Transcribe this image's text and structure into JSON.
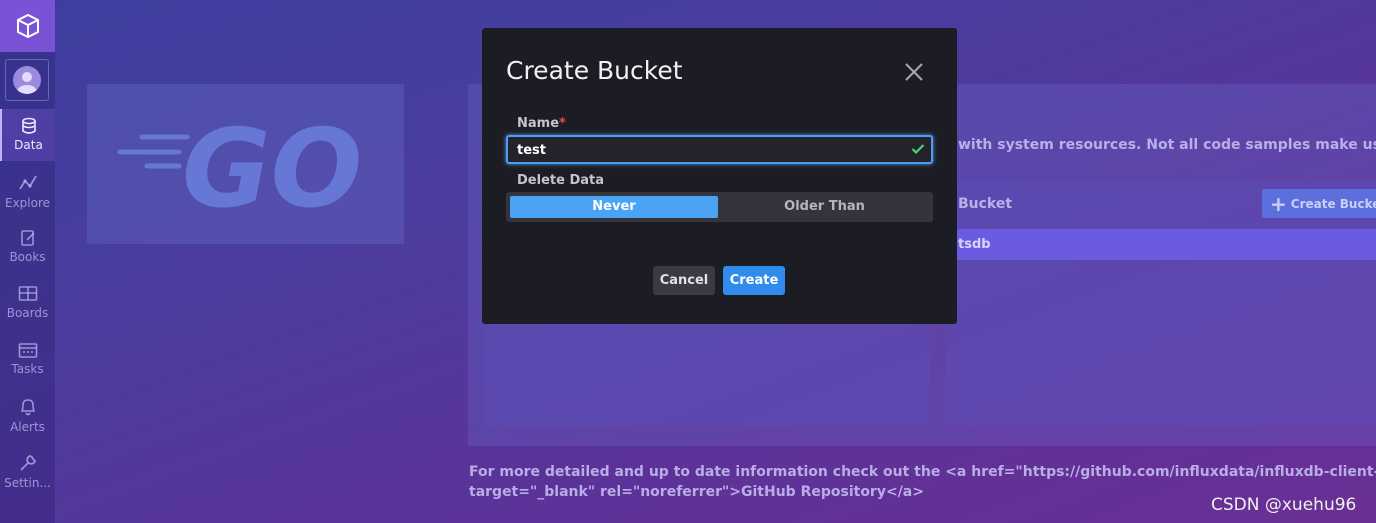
{
  "sidebar": {
    "items": [
      {
        "label": "Data",
        "icon": "database-icon"
      },
      {
        "label": "Explore",
        "icon": "graph-icon"
      },
      {
        "label": "Books",
        "icon": "notebook-icon"
      },
      {
        "label": "Boards",
        "icon": "dashboard-icon"
      },
      {
        "label": "Tasks",
        "icon": "calendar-icon"
      },
      {
        "label": "Alerts",
        "icon": "bell-icon"
      },
      {
        "label": "Settin...",
        "icon": "wrench-icon"
      }
    ]
  },
  "background": {
    "logo_text": "GO",
    "system_resources_text": "with system resources. Not all code samples make use o",
    "bucket_header": "Bucket",
    "create_bucket_label": "Create Bucke",
    "bucket_row": "tsdb",
    "info_line1": "For more detailed and up to date information check out the <a href=\"https://github.com/influxdata/influxdb-client-go\"",
    "info_line2": "target=\"_blank\" rel=\"noreferrer\">GitHub Repository</a>"
  },
  "modal": {
    "title": "Create Bucket",
    "name_label": "Name",
    "required_mark": "*",
    "name_value": "test",
    "delete_data_label": "Delete Data",
    "option_never": "Never",
    "option_older": "Older Than",
    "cancel_label": "Cancel",
    "create_label": "Create"
  },
  "watermark": "CSDN @xuehu96",
  "colors": {
    "accent": "#4aa3f5",
    "primary_button": "#2f8cec",
    "modal_bg": "#1c1c24",
    "required": "#e84b5b",
    "valid": "#4bd37a"
  }
}
